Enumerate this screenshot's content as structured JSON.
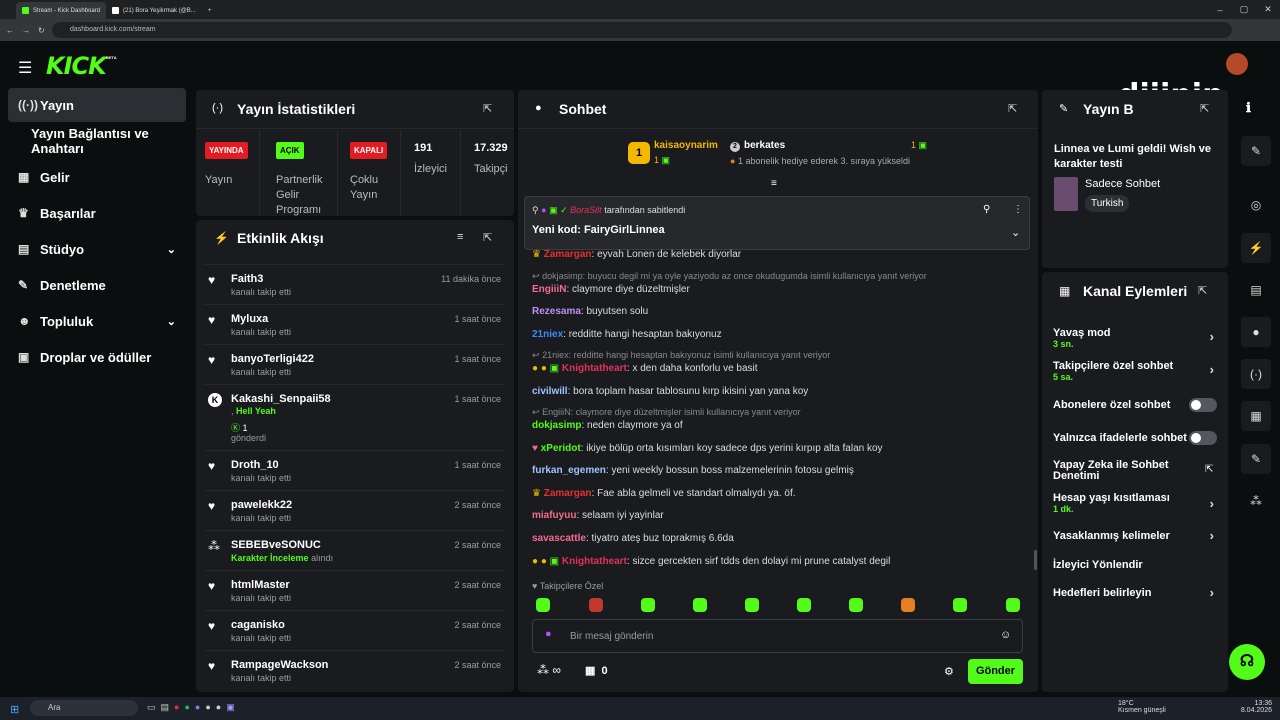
{
  "browser": {
    "tabs": [
      "Stream - Kick Dashboard",
      "(21) Bora Yeşilırmak (@B..."
    ],
    "url": "dashboard.kick.com/stream"
  },
  "header": {
    "logo": "KICK",
    "beta": "BETA",
    "watermark": "dijipin"
  },
  "sidebar": {
    "items": [
      {
        "label": "Yayın",
        "icon": "broadcast-icon"
      },
      {
        "label": "Yayın Bağlantısı ve Anahtarı",
        "icon": ""
      },
      {
        "label": "Gelir",
        "icon": "chart-icon"
      },
      {
        "label": "Başarılar",
        "icon": "trophy-icon"
      },
      {
        "label": "Stüdyo",
        "icon": "grid-icon"
      },
      {
        "label": "Denetleme",
        "icon": "wrench-icon"
      },
      {
        "label": "Topluluk",
        "icon": "people-icon"
      },
      {
        "label": "Droplar ve ödüller",
        "icon": "gift-icon"
      }
    ]
  },
  "stats": {
    "title": "Yayın İstatistikleri",
    "items": [
      {
        "badge": "YAYINDA",
        "label": "Yayın",
        "color": "#e31b23"
      },
      {
        "badge": "AÇIK",
        "label": "Partnerlik Gelir Programı",
        "color": "#53fc18"
      },
      {
        "badge": "KAPALI",
        "label": "Çoklu Yayın",
        "color": "#e31b23"
      },
      {
        "value": "191",
        "label": "İzleyici"
      },
      {
        "value": "17.329",
        "label": "Takipçi"
      }
    ]
  },
  "activity": {
    "title": "Etkinlik Akışı",
    "items": [
      {
        "name": "Faith3",
        "desc": "kanalı takip etti",
        "time": "11 dakika önce",
        "icon": "heart-icon"
      },
      {
        "name": "Myluxa",
        "desc": "kanalı takip etti",
        "time": "1 saat önce",
        "icon": "heart-icon"
      },
      {
        "name": "banyoTerligi422",
        "desc": "kanalı takip etti",
        "time": "1 saat önce",
        "icon": "heart-icon"
      },
      {
        "name": "Kakashi_Senpaii58",
        "desc": "gönderdi",
        "extra": "Hell Yeah",
        "count": "1",
        "time": "1 saat önce",
        "icon": "kick-icon"
      },
      {
        "name": "Droth_10",
        "desc": "kanalı takip etti",
        "time": "1 saat önce",
        "icon": "heart-icon"
      },
      {
        "name": "pawelekk22",
        "desc": "kanalı takip etti",
        "time": "2 saat önce",
        "icon": "heart-icon"
      },
      {
        "name": "SEBEBveSONUC",
        "desc": "alındı",
        "extra": "Karakter İnceleme",
        "time": "2 saat önce",
        "icon": "dots-icon"
      },
      {
        "name": "htmlMaster",
        "desc": "kanalı takip etti",
        "time": "2 saat önce",
        "icon": "heart-icon"
      },
      {
        "name": "caganisko",
        "desc": "kanalı takip etti",
        "time": "2 saat önce",
        "icon": "heart-icon"
      },
      {
        "name": "RampageWackson",
        "desc": "kanalı takip etti",
        "time": "2 saat önce",
        "icon": "heart-icon"
      }
    ]
  },
  "chat": {
    "title": "Sohbet",
    "leaderboard": [
      {
        "rank": "1",
        "name": "kaisaoynarim",
        "count": "1"
      },
      {
        "rank": "2",
        "name": "berkates",
        "count": "1",
        "note": "1 abonelik hediye ederek 3. sıraya yükseldi"
      }
    ],
    "pinned": {
      "by": "BoraSilt",
      "label": "tarafından sabitlendi",
      "text": "Yeni kod: FairyGirlLinnea"
    },
    "messages": [
      {
        "type": "msg",
        "user": "Zamargan",
        "color": "#e23131",
        "text": ": eyvah Lonen de kelebek diyorlar"
      },
      {
        "type": "reply",
        "text": "dokjasimp: buyucu degil mi ya oyle yaziyodu az once okudugumda isimli kullanıcıya yanıt veriyor"
      },
      {
        "type": "msg",
        "user": "EngiiiN",
        "color": "#f56c8e",
        "text": ": claymore diye düzeltmişler"
      },
      {
        "type": "msg",
        "user": "Rezesama",
        "color": "#c28cf6",
        "text": ": buyutsen solu"
      },
      {
        "type": "msg",
        "user": "21niex",
        "color": "#3b8cf5",
        "text": ": redditte hangi hesaptan bakıyonuz"
      },
      {
        "type": "reply",
        "text": "21niex: redditte hangi hesaptan bakıyonuz isimli kullanıcıya yanıt veriyor"
      },
      {
        "type": "msg",
        "user": "Knightatheart",
        "color": "#e2315a",
        "text": ": x den daha konforlu ve basit",
        "badges": true
      },
      {
        "type": "msg",
        "user": "civilwill",
        "color": "#9ec4ff",
        "text": ": bora toplam hasar tablosunu kırp ikisini yan yana koy"
      },
      {
        "type": "reply",
        "text": "EngiiiN: claymore diye düzeltmişler isimli kullanıcıya yanıt veriyor"
      },
      {
        "type": "msg",
        "user": "dokjasimp",
        "color": "#53fc18",
        "text": ": neden claymore ya of"
      },
      {
        "type": "msg",
        "user": "xPeridot",
        "color": "#53fc18",
        "text": ": ikiye bölüp orta kısımları koy sadece dps yerini kırpıp alta falan koy"
      },
      {
        "type": "msg",
        "user": "furkan_egemen",
        "color": "#9ec4ff",
        "text": ": yeni weekly bossun boss malzemelerinin fotosu gelmiş"
      },
      {
        "type": "msg",
        "user": "Zamargan",
        "color": "#e23131",
        "text": ": Fae abla gelmeli ve standart olmalıydı ya. öf."
      },
      {
        "type": "msg",
        "user": "miafuyuu",
        "color": "#f56c8e",
        "text": ": selaam iyi yayinlar"
      },
      {
        "type": "msg",
        "user": "savascattle",
        "color": "#f56c8e",
        "text": ": tiyatro ateş buz toprakmış 6.6da"
      },
      {
        "type": "msg",
        "user": "Knightatheart",
        "color": "#e2315a",
        "text": ": sizce gercekten sirf tdds den dolayi mi prune catalyst degil",
        "badges": true
      }
    ],
    "emote_label": "Takipçilere Özel",
    "input_placeholder": "Bir mesaj gönderin",
    "infinity": "∞",
    "store_count": "0",
    "send": "Gönder"
  },
  "stream_info": {
    "title": "Yayın Bilgisi",
    "description": "Linnea ve Lumi geldi! Wish ve karakter testi",
    "category": "Sadece Sohbet",
    "tag": "Turkish"
  },
  "channel": {
    "title": "Kanal Eylemleri",
    "items": [
      {
        "label": "Yavaş mod",
        "sub": "3 sn.",
        "kind": "chevron"
      },
      {
        "label": "Takipçilere özel sohbet",
        "sub": "5 sa.",
        "kind": "chevron"
      },
      {
        "label": "Abonelere özel sohbet",
        "sub": "",
        "kind": "toggle"
      },
      {
        "label": "Yalnızca ifadelerle sohbet",
        "sub": "",
        "kind": "toggle"
      },
      {
        "label": "Yapay Zeka ile Sohbet Denetimi",
        "sub": "",
        "kind": "external"
      },
      {
        "label": "Hesap yaşı kısıtlaması",
        "sub": "1 dk.",
        "kind": "chevron"
      },
      {
        "label": "Yasaklanmış kelimeler",
        "sub": "",
        "kind": "chevron"
      },
      {
        "label": "İzleyici Yönlendir",
        "sub": "",
        "kind": "none"
      },
      {
        "label": "Hedefleri belirleyin",
        "sub": "",
        "kind": "chevron"
      }
    ]
  },
  "taskbar": {
    "search": "Ara",
    "weather": "18°C",
    "weather_desc": "Kısmen güneşli",
    "time": "13:36",
    "date": "8.04.2026"
  },
  "colors": {
    "accent": "#53fc18",
    "panel": "#191b1f",
    "bg": "#0b0e0f"
  }
}
